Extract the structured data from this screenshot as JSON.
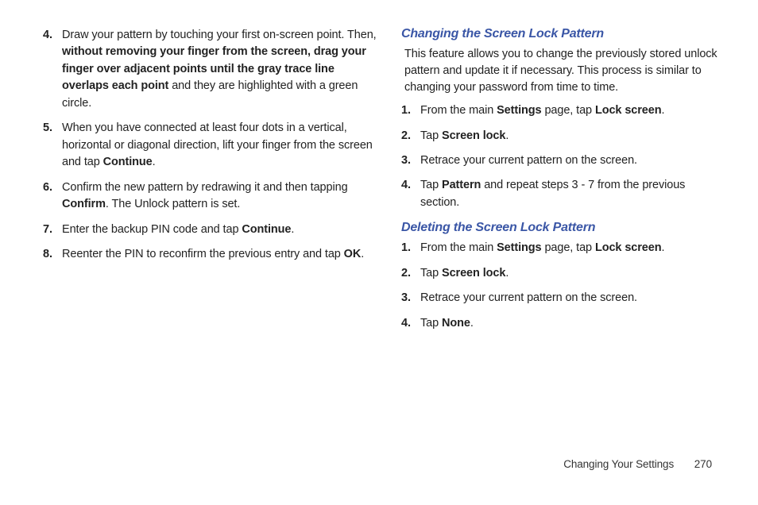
{
  "left": {
    "items": [
      {
        "num": "4.",
        "segments": [
          {
            "t": "Draw your pattern by touching your first on-screen point. Then, ",
            "b": false
          },
          {
            "t": "without removing your finger from the screen, drag your finger over adjacent points until the gray trace line overlaps each point",
            "b": true
          },
          {
            "t": " and they are highlighted with a green circle.",
            "b": false
          }
        ]
      },
      {
        "num": "5.",
        "segments": [
          {
            "t": "When you have connected at least four dots in a vertical, horizontal or diagonal direction, lift your finger from the screen and tap ",
            "b": false
          },
          {
            "t": "Continue",
            "b": true
          },
          {
            "t": ".",
            "b": false
          }
        ]
      },
      {
        "num": "6.",
        "segments": [
          {
            "t": "Confirm the new pattern by redrawing it and then tapping ",
            "b": false
          },
          {
            "t": "Confirm",
            "b": true
          },
          {
            "t": ". The Unlock pattern is set.",
            "b": false
          }
        ]
      },
      {
        "num": "7.",
        "segments": [
          {
            "t": "Enter the backup PIN code and tap ",
            "b": false
          },
          {
            "t": "Continue",
            "b": true
          },
          {
            "t": ".",
            "b": false
          }
        ]
      },
      {
        "num": "8.",
        "segments": [
          {
            "t": "Reenter the PIN to reconfirm the previous entry and tap ",
            "b": false
          },
          {
            "t": "OK",
            "b": true
          },
          {
            "t": ".",
            "b": false
          }
        ]
      }
    ]
  },
  "right": {
    "section1": {
      "heading": "Changing the Screen Lock Pattern",
      "intro": "This feature allows you to change the previously stored unlock pattern and update it if necessary. This process is similar to changing your password from time to time.",
      "items": [
        {
          "num": "1.",
          "segments": [
            {
              "t": "From the main ",
              "b": false
            },
            {
              "t": "Settings",
              "b": true
            },
            {
              "t": " page, tap ",
              "b": false
            },
            {
              "t": "Lock screen",
              "b": true
            },
            {
              "t": ".",
              "b": false
            }
          ]
        },
        {
          "num": "2.",
          "segments": [
            {
              "t": "Tap ",
              "b": false
            },
            {
              "t": "Screen lock",
              "b": true
            },
            {
              "t": ".",
              "b": false
            }
          ]
        },
        {
          "num": "3.",
          "segments": [
            {
              "t": "Retrace your current pattern on the screen.",
              "b": false
            }
          ]
        },
        {
          "num": "4.",
          "segments": [
            {
              "t": "Tap ",
              "b": false
            },
            {
              "t": "Pattern",
              "b": true
            },
            {
              "t": " and repeat steps 3 - 7 from the previous section.",
              "b": false
            }
          ]
        }
      ]
    },
    "section2": {
      "heading": "Deleting the Screen Lock Pattern",
      "items": [
        {
          "num": "1.",
          "segments": [
            {
              "t": "From the main ",
              "b": false
            },
            {
              "t": "Settings",
              "b": true
            },
            {
              "t": " page, tap ",
              "b": false
            },
            {
              "t": "Lock screen",
              "b": true
            },
            {
              "t": ".",
              "b": false
            }
          ]
        },
        {
          "num": "2.",
          "segments": [
            {
              "t": "Tap ",
              "b": false
            },
            {
              "t": "Screen lock",
              "b": true
            },
            {
              "t": ".",
              "b": false
            }
          ]
        },
        {
          "num": "3.",
          "segments": [
            {
              "t": "Retrace your current pattern on the screen.",
              "b": false
            }
          ]
        },
        {
          "num": "4.",
          "segments": [
            {
              "t": "Tap ",
              "b": false
            },
            {
              "t": "None",
              "b": true
            },
            {
              "t": ".",
              "b": false
            }
          ]
        }
      ]
    }
  },
  "footer": {
    "label": "Changing Your Settings",
    "page": "270"
  }
}
